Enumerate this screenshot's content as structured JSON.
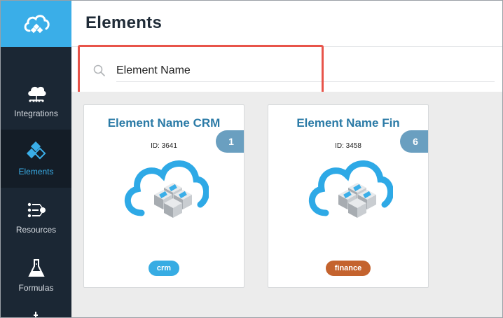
{
  "header": {
    "title": "Elements"
  },
  "search": {
    "value": "Element Name",
    "placeholder": ""
  },
  "sidebar": {
    "items": [
      {
        "label": "Integrations",
        "icon": "cloud-network-icon"
      },
      {
        "label": "Elements",
        "icon": "elements-cubes-icon",
        "active": true
      },
      {
        "label": "Resources",
        "icon": "resources-icon"
      },
      {
        "label": "Formulas",
        "icon": "flask-icon"
      }
    ]
  },
  "cards": [
    {
      "title": "Element Name CRM",
      "id_text": "ID: 3641",
      "count": "1",
      "tag": "crm",
      "tag_color": "#37ace3"
    },
    {
      "title": "Element Name Fin",
      "id_text": "ID: 3458",
      "count": "6",
      "tag": "finance",
      "tag_color": "#c4632e"
    }
  ],
  "colors": {
    "sidebar_bg": "#1b2734",
    "logo_bg": "#3aaee8",
    "accent": "#3aaee8",
    "card_title": "#2a7aa6",
    "badge": "#6a9fc0",
    "highlight": "#e8544a"
  }
}
